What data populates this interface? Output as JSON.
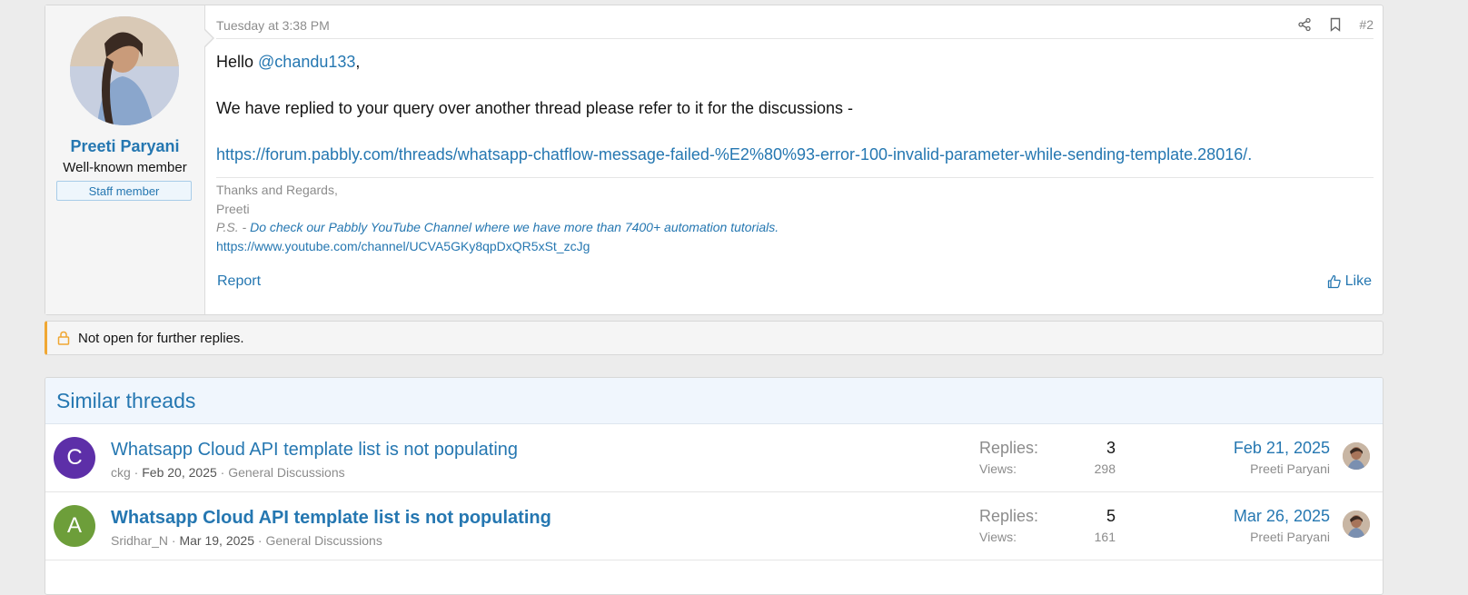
{
  "post": {
    "author": {
      "name": "Preeti Paryani",
      "title": "Well-known member",
      "badge": "Staff member"
    },
    "date": "Tuesday at 3:38 PM",
    "number": "#2",
    "greeting": "Hello ",
    "mention": "@chandu133",
    "greeting_suffix": ",",
    "paragraph": "We have replied to your query over another thread please refer to it for the discussions -",
    "link": "https://forum.pabbly.com/threads/whatsapp-chatflow-message-failed-%E2%80%93-error-100-invalid-parameter-while-sending-template.28016/.",
    "signature": {
      "line1": "Thanks and Regards,",
      "line2": "Preeti",
      "ps_prefix": "P.S. - ",
      "ps_link": "Do check our Pabbly YouTube Channel where we have more than 7400+ automation tutorials.",
      "youtube_link": "https://www.youtube.com/channel/UCVA5GKy8qpDxQR5xSt_zcJg"
    },
    "report_label": "Report",
    "like_label": "Like"
  },
  "notice": {
    "text": "Not open for further replies."
  },
  "similar": {
    "heading": "Similar threads",
    "threads": [
      {
        "avatar_letter": "C",
        "avatar_color": "#5d2fa8",
        "title": "Whatsapp Cloud API template list is not populating",
        "author": "ckg",
        "date": "Feb 20, 2025",
        "forum": "General Discussions",
        "replies_label": "Replies:",
        "replies": "3",
        "views_label": "Views:",
        "views": "298",
        "last_date": "Feb 21, 2025",
        "last_user": "Preeti Paryani"
      },
      {
        "avatar_letter": "A",
        "avatar_color": "#6d9e3a",
        "title": "Whatsapp Cloud API template list is not populating",
        "author": "Sridhar_N",
        "date": "Mar 19, 2025",
        "forum": "General Discussions",
        "replies_label": "Replies:",
        "replies": "5",
        "views_label": "Views:",
        "views": "161",
        "last_date": "Mar 26, 2025",
        "last_user": "Preeti Paryani"
      }
    ]
  },
  "colors": {
    "link": "#2577b1",
    "notice_accent": "#f0a733"
  },
  "icons": [
    "share-icon",
    "bookmark-icon",
    "like-icon",
    "lock-icon"
  ]
}
